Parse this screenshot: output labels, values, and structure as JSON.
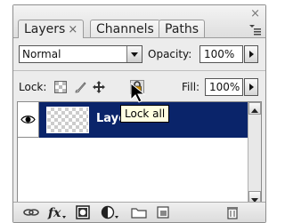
{
  "tabs": [
    {
      "label": "Layers",
      "close": "×",
      "active": true
    },
    {
      "label": "Channels",
      "active": false
    },
    {
      "label": "Paths",
      "active": false
    }
  ],
  "window": {
    "close_glyph": "×",
    "menu_icon": "panel-menu-icon"
  },
  "blend_mode": {
    "value": "Normal"
  },
  "opacity": {
    "label": "Opacity:",
    "value": "100%"
  },
  "lock": {
    "label": "Lock:",
    "icons": [
      "lock-transparent-pixels-icon",
      "lock-image-pixels-icon",
      "lock-position-icon",
      "lock-all-icon"
    ]
  },
  "fill": {
    "label": "Fill:",
    "value": "100%"
  },
  "layers": [
    {
      "name": "Layer",
      "visible": true,
      "selected": true
    }
  ],
  "tooltip": {
    "text": "Lock all"
  },
  "bottom_bar": {
    "icons": [
      "link-layers-icon",
      "fx-icon",
      "layer-mask-icon",
      "adjustment-layer-icon",
      "new-group-icon",
      "new-layer-icon",
      "trash-icon"
    ]
  },
  "colors": {
    "selection": "#0a246a",
    "tooltip_bg": "#ffffe1",
    "panel_bg": "#ececec"
  }
}
